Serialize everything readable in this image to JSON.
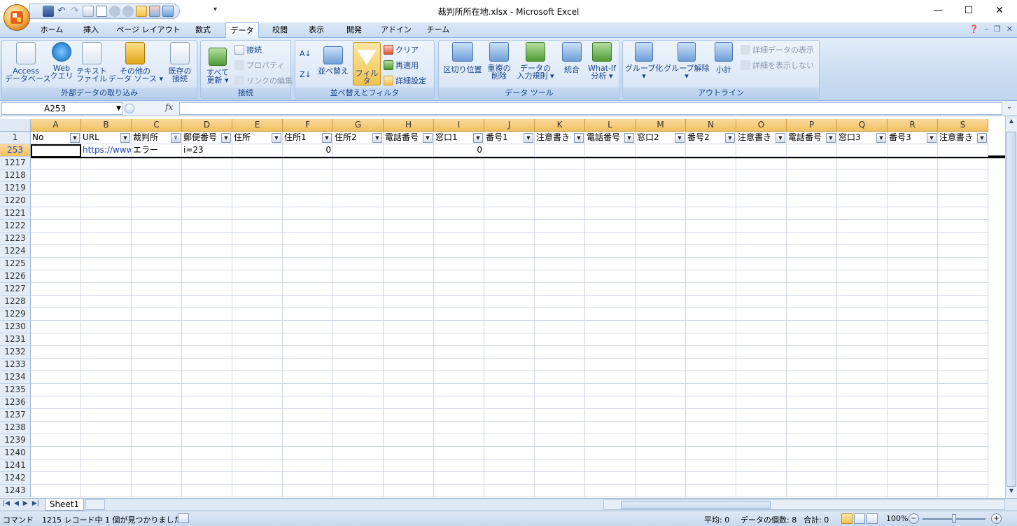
{
  "window": {
    "title": "裁判所所在地.xlsx - Microsoft Excel",
    "minimize": "—",
    "maximize": "☐",
    "close": "✕"
  },
  "tabs": [
    "ホーム",
    "挿入",
    "ページ レイアウト",
    "数式",
    "データ",
    "校閲",
    "表示",
    "開発",
    "アドイン",
    "チーム"
  ],
  "active_tab": "データ",
  "ribbon": {
    "external": {
      "label": "外部データの取り込み",
      "access": "Access\nデータベース",
      "web": "Web\nクエリ",
      "text": "テキスト\nファイル",
      "other": "その他の\nデータ ソース ▾",
      "existing": "既存の\n接続"
    },
    "connections": {
      "label": "接続",
      "refresh": "すべて\n更新 ▾",
      "connections": "接続",
      "properties": "プロパティ",
      "edit_links": "リンクの編集"
    },
    "sortfilter": {
      "label": "並べ替えとフィルタ",
      "sort": "並べ替え",
      "filter": "フィルタ",
      "clear": "クリア",
      "reapply": "再適用",
      "advanced": "詳細設定"
    },
    "datatools": {
      "label": "データ ツール",
      "text_to_columns": "区切り位置",
      "remove_dup": "重複の\n削除",
      "validation": "データの\n入力規則 ▾",
      "consolidate": "統合",
      "whatif": "What-If\n分析 ▾"
    },
    "outline": {
      "label": "アウトライン",
      "group": "グループ化\n▾",
      "ungroup": "グループ解除\n▾",
      "subtotal": "小計",
      "show_detail": "詳細データの表示",
      "hide_detail": "詳細を表示しない"
    }
  },
  "formula_bar": {
    "name_box": "A253",
    "fx": "fx",
    "value": ""
  },
  "columns": [
    "A",
    "B",
    "C",
    "D",
    "E",
    "F",
    "G",
    "H",
    "I",
    "J",
    "K",
    "L",
    "M",
    "N",
    "O",
    "P",
    "Q",
    "R",
    "S"
  ],
  "header_row": {
    "number": "1",
    "cells": [
      "No",
      "URL",
      "裁判所",
      "郵便番号",
      "住所",
      "住所1",
      "住所2",
      "電話番号",
      "窓口1",
      "番号1",
      "注意書き",
      "電話番号",
      "窓口2",
      "番号2",
      "注意書き",
      "電話番号",
      "窓口3",
      "番号3",
      "注意書き"
    ]
  },
  "data_row": {
    "number": "253",
    "cells": [
      "",
      "https://www",
      "エラー",
      "i=23",
      "",
      "0",
      "",
      "",
      "0",
      "",
      "",
      "",
      "",
      "",
      "",
      "",
      "",
      "",
      ""
    ]
  },
  "empty_rows": [
    "1217",
    "1218",
    "1219",
    "1220",
    "1221",
    "1222",
    "1223",
    "1224",
    "1225",
    "1226",
    "1227",
    "1228",
    "1229",
    "1230",
    "1231",
    "1232",
    "1233",
    "1234",
    "1235",
    "1236",
    "1237",
    "1238",
    "1239",
    "1240",
    "1241",
    "1242",
    "1243"
  ],
  "sheet_tabs": [
    "Sheet1"
  ],
  "status": {
    "mode": "コマンド",
    "filter_msg": "1215 レコード中 1 個が見つかりました",
    "average": "平均: 0",
    "count": "データの個数: 8",
    "sum": "合計: 0",
    "zoom": "100%"
  },
  "colors": {
    "accent": "#f1c15f",
    "ribbon": "#cadcf1",
    "link": "#1f3fbf"
  }
}
